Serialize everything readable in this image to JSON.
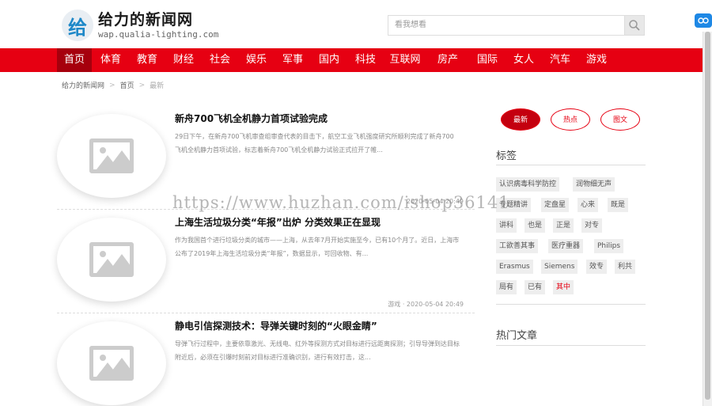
{
  "header": {
    "logo_char": "给",
    "site_title": "给力的新闻网",
    "site_url": "wap.qualia-lighting.com",
    "search_placeholder": "看我想看"
  },
  "nav": [
    "首页",
    "体育",
    "教育",
    "财经",
    "社会",
    "娱乐",
    "军事",
    "国内",
    "科技",
    "互联网",
    "房产",
    "国际",
    "女人",
    "汽车",
    "游戏"
  ],
  "breadcrumb": [
    "给力的新闻网",
    "首页",
    "最新"
  ],
  "articles": [
    {
      "title": "新舟700飞机全机静力首项试验完成",
      "desc": "29日下午，在新舟700飞机审查组审查代表的目击下，航空工业飞机强度研究所顺利完成了新舟700飞机全机静力首项试验，标志着新舟700飞机全机静力试验正式拉开了帷...",
      "meta": "2020-05-04 20:49"
    },
    {
      "title": "上海生活垃圾分类“年报”出炉 分类效果正在显现",
      "desc": "作为我国首个进行垃圾分类的城市——上海，从去年7月开始实施至今，已有10个月了。近日，上海市公布了2019年上海生活垃圾分类“年报”，数据显示，可回收物、有...",
      "meta": "游戏 · 2020-05-04 20:49"
    },
    {
      "title": "静电引信探测技术：导弹关键时刻的“火眼金睛”",
      "desc": "导弹飞行过程中，主要依靠激光、无线电、红外等探测方式对目标进行远距离探测；引导导弹到达目标附近后，必须在引爆时刻前对目标进行准确识别，进行有效打击，这...",
      "meta": ""
    }
  ],
  "watermark": "https://www.huzhan.com/ishop36141",
  "sidebar": {
    "tabs": [
      "最新",
      "热点",
      "图文"
    ],
    "tags_heading": "标签",
    "tags": [
      "认识病毒科学防控",
      "润物细无声",
      "专题精讲",
      "定盘星",
      "心来",
      "既是",
      "讲科",
      "也是",
      "正是",
      "对专",
      "工欲善其事",
      "医疗重器",
      "Philips",
      "Erasmus",
      "Siemens",
      "效专",
      "利共",
      "局有",
      "已有",
      "其中"
    ],
    "hot_heading": "热门文章"
  },
  "colors": {
    "nav_red": "#e60012",
    "nav_active": "#a6000d",
    "accent": "#e60012"
  }
}
